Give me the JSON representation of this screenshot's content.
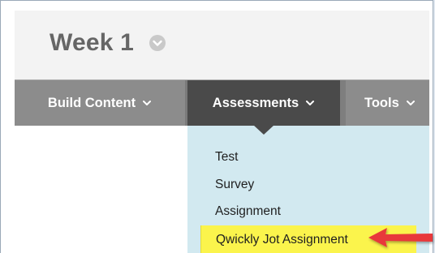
{
  "header": {
    "title": "Week 1",
    "title_menu_icon": "chevron-down-circle-icon"
  },
  "toolbar": {
    "items": [
      {
        "label": "Build Content",
        "icon": "chevron-down-icon"
      },
      {
        "label": "Assessments",
        "icon": "chevron-down-icon",
        "active": true
      },
      {
        "label": "Tools",
        "icon": "chevron-down-icon"
      }
    ]
  },
  "dropdown": {
    "items": [
      {
        "label": "Test"
      },
      {
        "label": "Survey"
      },
      {
        "label": "Assignment"
      },
      {
        "label": "Qwickly Jot Assignment",
        "highlighted": true
      }
    ]
  },
  "annotation": {
    "icon": "red-arrow-icon",
    "color": "#e8383b"
  },
  "colors": {
    "toolbar": "#8c8c8c",
    "active_tab": "#4a4a4a",
    "dropdown_bg": "#d2e9f0",
    "highlight": "#fbf44c"
  }
}
